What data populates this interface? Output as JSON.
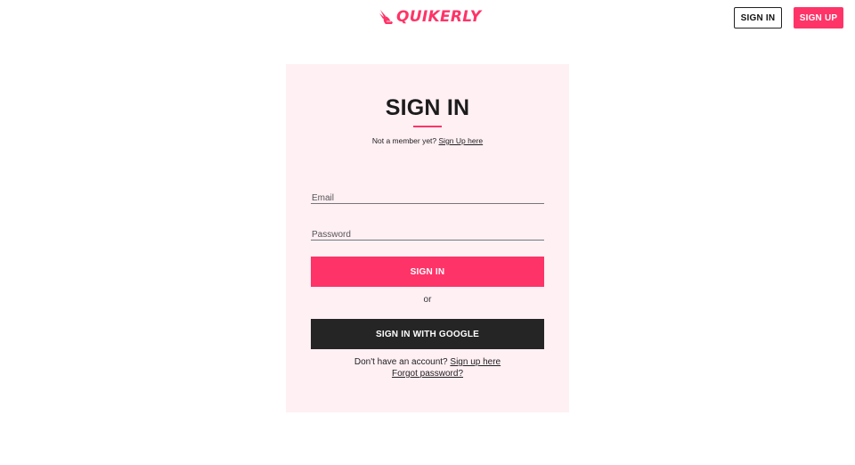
{
  "header": {
    "logo_text": "QUIKERLY",
    "logo_icon": "winged-shoe-icon",
    "signin_label": "SIGN IN",
    "signup_label": "SIGN UP"
  },
  "card": {
    "title": "SIGN IN",
    "subtext_prefix": "Not a member yet?",
    "subtext_link": "Sign Up here",
    "email_placeholder": "Email",
    "password_placeholder": "Password",
    "signin_button": "SIGN IN",
    "or_text": "or",
    "google_button": "SIGN IN WITH GOOGLE",
    "no_account_prefix": "Don't have an account?",
    "no_account_link": "Sign up here",
    "forgot_password": "Forgot password?"
  },
  "colors": {
    "accent": "#fe3468",
    "card_bg": "#fff0f4",
    "dark_button": "#252525"
  }
}
